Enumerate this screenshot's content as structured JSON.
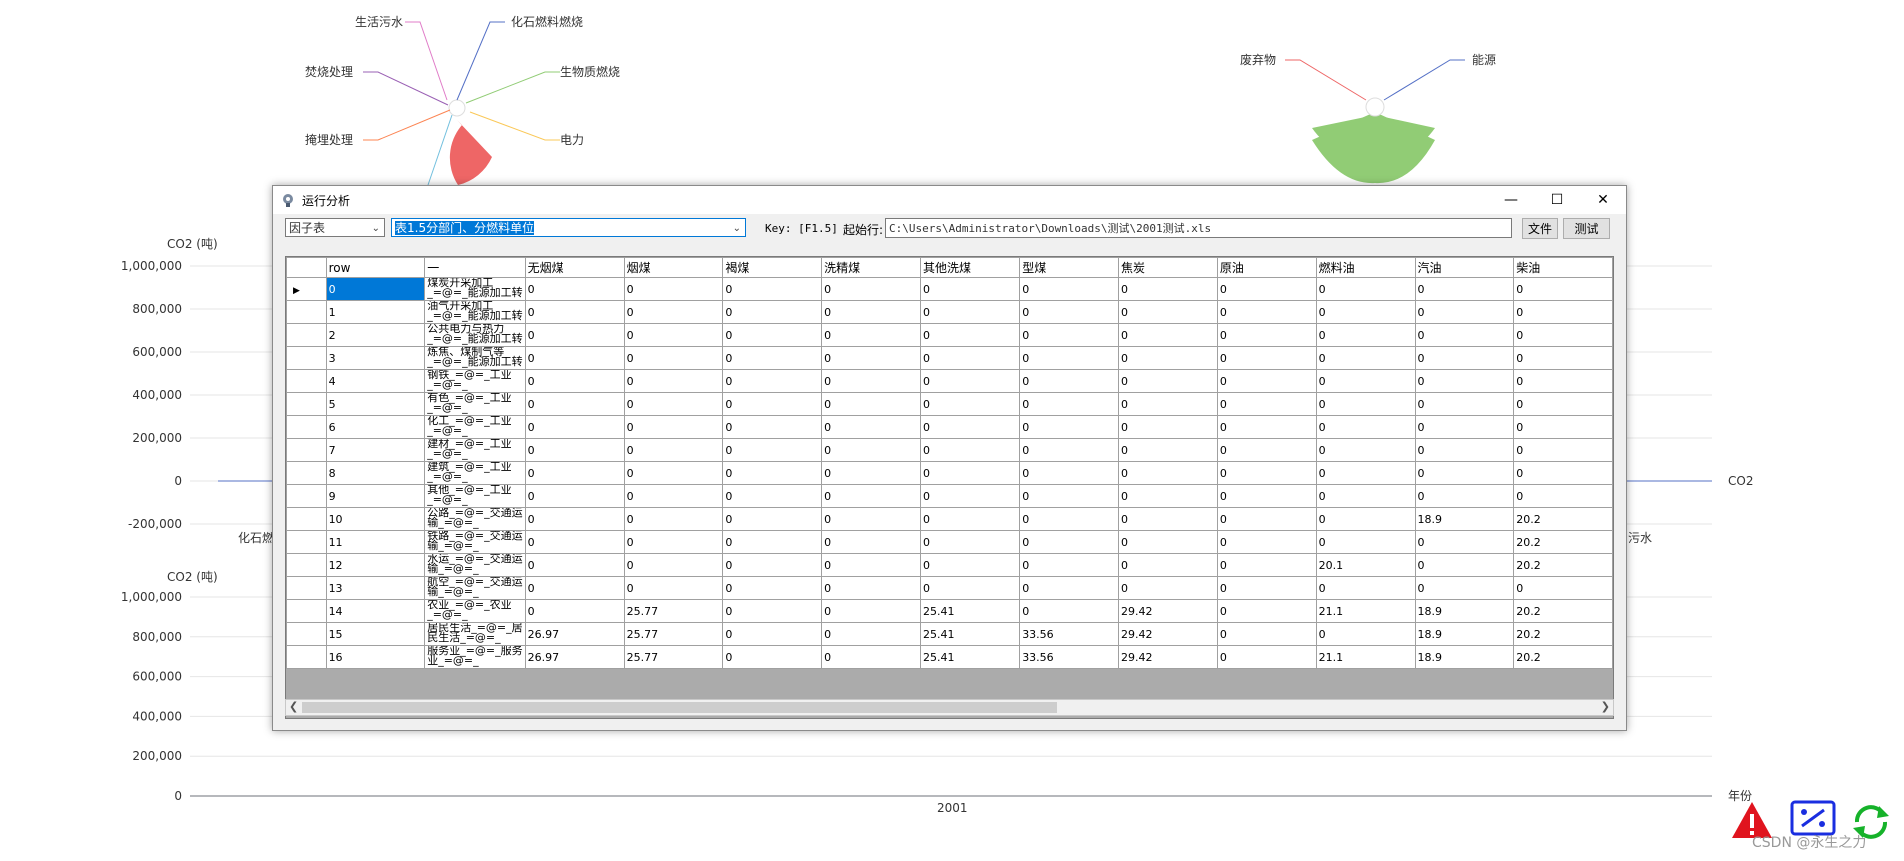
{
  "bg": {
    "pie1_labels": [
      "生活污水",
      "化石燃料燃烧",
      "焚烧处理",
      "生物质燃烧",
      "掩埋处理",
      "电力"
    ],
    "pie2_labels": [
      "废弃物",
      "能源"
    ],
    "chart1": {
      "y_unit": "CO2 (吨)",
      "yticks": [
        "1,000,000",
        "800,000",
        "600,000",
        "400,000",
        "200,000",
        "0",
        "-200,000"
      ],
      "x_left_partial": "化石燃",
      "x_right_partial": "污水",
      "legend": "CO2"
    },
    "chart2": {
      "y_unit": "CO2 (吨)",
      "yticks": [
        "1,000,000",
        "800,000",
        "600,000",
        "400,000",
        "200,000",
        "0"
      ],
      "x_label": "2001",
      "x_axis_name": "年份"
    },
    "watermark": "CSDN @永生之力"
  },
  "window": {
    "title": "运行分析",
    "factor_combo": "因子表",
    "table_combo": "表1.5分部门、分燃料单位",
    "key_label": "Key: [F1.5]",
    "start_row_label": "起始行:",
    "file_path": "C:\\Users\\Administrator\\Downloads\\测试\\2001测试.xls",
    "file_button": "文件",
    "test_button": "测试"
  },
  "grid": {
    "columns": [
      "row",
      "一",
      "无烟煤",
      "烟煤",
      "褐煤",
      "洗精煤",
      "其他洗煤",
      "型煤",
      "焦炭",
      "原油",
      "燃料油",
      "汽油",
      "柴油"
    ],
    "rows": [
      [
        "0",
        "煤炭开采加工\n_=@=_能源加工转",
        "0",
        "0",
        "0",
        "0",
        "0",
        "0",
        "0",
        "0",
        "0",
        "0",
        "0"
      ],
      [
        "1",
        "油气开采加工\n_=@=_能源加工转",
        "0",
        "0",
        "0",
        "0",
        "0",
        "0",
        "0",
        "0",
        "0",
        "0",
        "0"
      ],
      [
        "2",
        "公共电力与热力\n_=@=_能源加工转",
        "0",
        "0",
        "0",
        "0",
        "0",
        "0",
        "0",
        "0",
        "0",
        "0",
        "0"
      ],
      [
        "3",
        "炼焦、煤制气等\n_=@=_能源加工转",
        "0",
        "0",
        "0",
        "0",
        "0",
        "0",
        "0",
        "0",
        "0",
        "0",
        "0"
      ],
      [
        "4",
        "钢铁_=@=_工业\n_=@=_",
        "0",
        "0",
        "0",
        "0",
        "0",
        "0",
        "0",
        "0",
        "0",
        "0",
        "0"
      ],
      [
        "5",
        "有色_=@=_工业\n_=@=_",
        "0",
        "0",
        "0",
        "0",
        "0",
        "0",
        "0",
        "0",
        "0",
        "0",
        "0"
      ],
      [
        "6",
        "化工_=@=_工业\n_=@=_",
        "0",
        "0",
        "0",
        "0",
        "0",
        "0",
        "0",
        "0",
        "0",
        "0",
        "0"
      ],
      [
        "7",
        "建材_=@=_工业\n_=@=_",
        "0",
        "0",
        "0",
        "0",
        "0",
        "0",
        "0",
        "0",
        "0",
        "0",
        "0"
      ],
      [
        "8",
        "建筑_=@=_工业\n_=@=_",
        "0",
        "0",
        "0",
        "0",
        "0",
        "0",
        "0",
        "0",
        "0",
        "0",
        "0"
      ],
      [
        "9",
        "其他_=@=_工业\n_=@=_",
        "0",
        "0",
        "0",
        "0",
        "0",
        "0",
        "0",
        "0",
        "0",
        "0",
        "0"
      ],
      [
        "10",
        "公路_=@=_交通运\n输_=@=_",
        "0",
        "0",
        "0",
        "0",
        "0",
        "0",
        "0",
        "0",
        "0",
        "18.9",
        "20.2"
      ],
      [
        "11",
        "铁路_=@=_交通运\n输_=@=_",
        "0",
        "0",
        "0",
        "0",
        "0",
        "0",
        "0",
        "0",
        "0",
        "0",
        "20.2"
      ],
      [
        "12",
        "水运_=@=_交通运\n输_=@=_",
        "0",
        "0",
        "0",
        "0",
        "0",
        "0",
        "0",
        "0",
        "20.1",
        "0",
        "20.2"
      ],
      [
        "13",
        "航空_=@=_交通运\n输_=@=_",
        "0",
        "0",
        "0",
        "0",
        "0",
        "0",
        "0",
        "0",
        "0",
        "0",
        "0"
      ],
      [
        "14",
        "农业_=@=_农业\n_=@=_",
        "0",
        "25.77",
        "0",
        "0",
        "25.41",
        "0",
        "29.42",
        "0",
        "21.1",
        "18.9",
        "20.2"
      ],
      [
        "15",
        "居民生活_=@=_居\n民生活_=@=_",
        "26.97",
        "25.77",
        "0",
        "0",
        "25.41",
        "33.56",
        "29.42",
        "0",
        "0",
        "18.9",
        "20.2"
      ],
      [
        "16",
        "服务业_=@=_服务\n业_=@=_",
        "26.97",
        "25.77",
        "0",
        "0",
        "25.41",
        "33.56",
        "29.42",
        "0",
        "21.1",
        "18.9",
        "20.2"
      ]
    ]
  }
}
